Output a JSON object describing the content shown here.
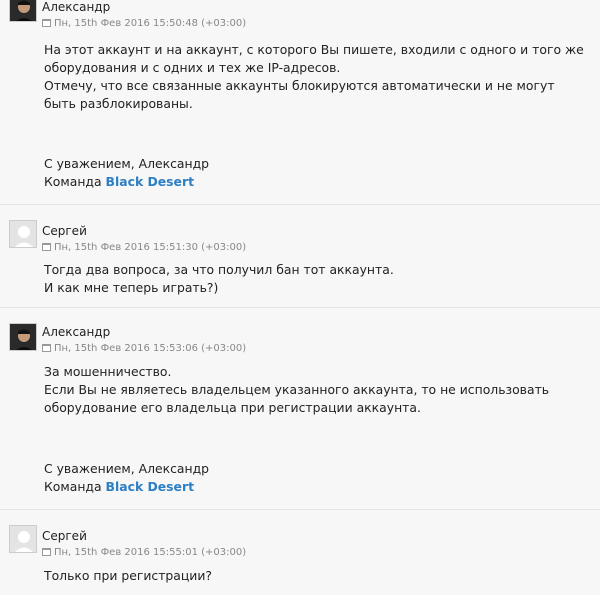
{
  "messages": [
    {
      "author": "Александр",
      "avatar": "staff-photo",
      "date": "Пн, 15th Фев 2016 15:50:48 (+03:00)",
      "lines": [
        "На этот аккаунт и на аккаунт, с которого Вы пишете, входили с одного и того же",
        "оборудования и с одних и тех же IP-адресов.",
        "Отмечу, что все связанные аккаунты блокируются автоматически и не могут",
        "быть разблокированы."
      ],
      "signature": {
        "regards": "С уважением, Александр",
        "team_prefix": "Команда",
        "team_name": "Black Desert"
      }
    },
    {
      "author": "Сергей",
      "avatar": "default-avatar",
      "date": "Пн, 15th Фев 2016 15:51:30 (+03:00)",
      "lines": [
        "Тогда два вопроса, за что получил бан тот аккаунта.",
        "И как мне теперь играть?)"
      ]
    },
    {
      "author": "Александр",
      "avatar": "staff-photo",
      "date": "Пн, 15th Фев 2016 15:53:06 (+03:00)",
      "lines": [
        "За мошенничество.",
        "Если Вы не являетесь владельцем указанного аккаунта, то не использовать",
        "оборудование его владельца при регистрации аккаунта."
      ],
      "signature": {
        "regards": "С уважением, Александр",
        "team_prefix": "Команда",
        "team_name": "Black Desert"
      }
    },
    {
      "author": "Сергей",
      "avatar": "default-avatar",
      "date": "Пн, 15th Фев 2016 15:55:01 (+03:00)",
      "lines": [
        "Только при регистрации?"
      ]
    }
  ],
  "colors": {
    "background": "#f7f7f7",
    "brand_link": "#2d7fc4",
    "date_text": "#888888",
    "separator": "#e4e4e4"
  }
}
